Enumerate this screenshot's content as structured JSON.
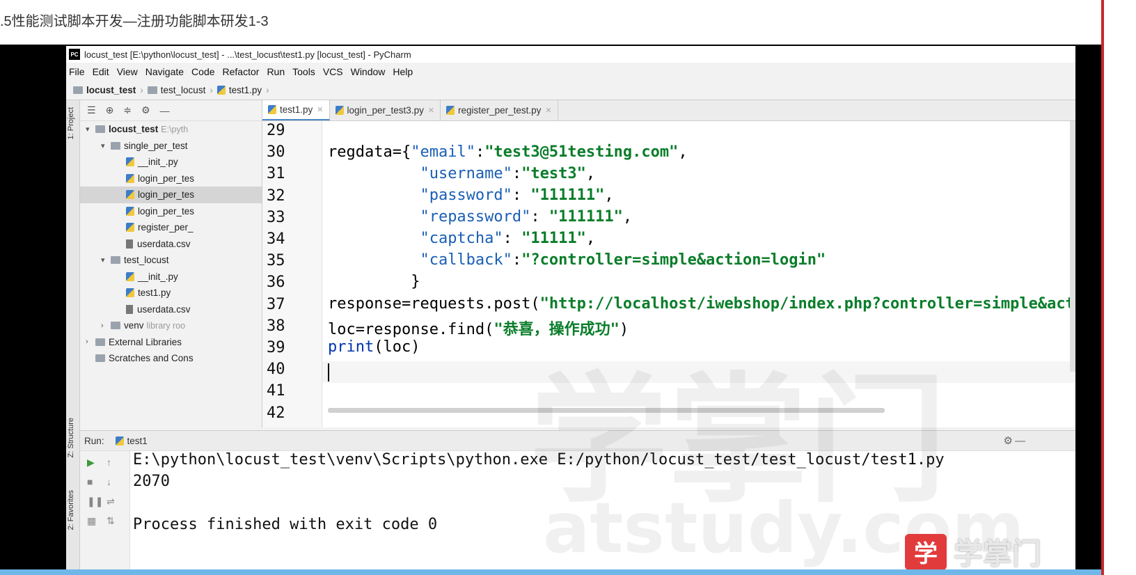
{
  "page_title": ".5性能测试脚本开发—注册功能脚本研发1-3",
  "ide": {
    "window_title": "locust_test [E:\\python\\locust_test] - ...\\test_locust\\test1.py [locust_test] - PyCharm",
    "logo_text": "PC",
    "menu": [
      "File",
      "Edit",
      "View",
      "Navigate",
      "Code",
      "Refactor",
      "Run",
      "Tools",
      "VCS",
      "Window",
      "Help"
    ],
    "breadcrumbs": [
      "locust_test",
      "test_locust",
      "test1.py"
    ],
    "side_labels": {
      "project": "1: Project",
      "structure": "Z: Structure",
      "favorites": "2: Favorites"
    },
    "project_tree": [
      {
        "label": "locust_test",
        "extra": "E:\\pyth",
        "indent": 0,
        "icon": "folder",
        "arrow": "▾",
        "bold": true
      },
      {
        "label": "single_per_test",
        "indent": 1,
        "icon": "folder",
        "arrow": "▾"
      },
      {
        "label": "__init_.py",
        "indent": 2,
        "icon": "py"
      },
      {
        "label": "login_per_tes",
        "indent": 2,
        "icon": "py"
      },
      {
        "label": "login_per_tes",
        "indent": 2,
        "icon": "py",
        "selected": true
      },
      {
        "label": "login_per_tes",
        "indent": 2,
        "icon": "py"
      },
      {
        "label": "register_per_",
        "indent": 2,
        "icon": "py"
      },
      {
        "label": "userdata.csv",
        "indent": 2,
        "icon": "csv"
      },
      {
        "label": "test_locust",
        "indent": 1,
        "icon": "folder",
        "arrow": "▾"
      },
      {
        "label": "__init_.py",
        "indent": 2,
        "icon": "py"
      },
      {
        "label": "test1.py",
        "indent": 2,
        "icon": "py"
      },
      {
        "label": "userdata.csv",
        "indent": 2,
        "icon": "csv"
      },
      {
        "label": "venv",
        "extra": "library roo",
        "indent": 1,
        "icon": "folder",
        "arrow": "›"
      },
      {
        "label": "External Libraries",
        "indent": 0,
        "icon": "lib",
        "arrow": "›"
      },
      {
        "label": "Scratches and Cons",
        "indent": 0,
        "icon": "scratch"
      }
    ],
    "tabs": [
      {
        "label": "test1.py",
        "active": true
      },
      {
        "label": "login_per_test3.py"
      },
      {
        "label": "register_per_test.py"
      }
    ],
    "line_numbers": [
      "29",
      "30",
      "31",
      "32",
      "33",
      "34",
      "35",
      "36",
      "37",
      "38",
      "39",
      "40",
      "41",
      "42"
    ],
    "code": {
      "l30a": "regdata={",
      "l30b": "\"email\"",
      "l30c": ":",
      "l30d": "\"test3@51testing.com\"",
      "l30e": ",",
      "l31a": "\"username\"",
      "l31b": ":",
      "l31c": "\"test3\"",
      "l31d": ",",
      "l32a": "\"password\"",
      "l32b": ": ",
      "l32c": "\"111111\"",
      "l32d": ",",
      "l33a": "\"repassword\"",
      "l33b": ": ",
      "l33c": "\"111111\"",
      "l33d": ",",
      "l34a": "\"captcha\"",
      "l34b": ": ",
      "l34c": "\"11111\"",
      "l34d": ",",
      "l35a": "\"callback\"",
      "l35b": ":",
      "l35c": "\"?controller=simple&action=login\"",
      "l36": "}",
      "l37a": "response=requests.post(",
      "l37b": "\"http://localhost/iwebshop/index.php?controller=simple&action",
      "l38a": "loc=response.find(",
      "l38b": "\"恭喜，操作成功\"",
      "l38c": ")",
      "l39a": "print",
      "l39b": "(loc)"
    },
    "run": {
      "label": "Run:",
      "tab": "test1",
      "console": [
        "E:\\python\\locust_test\\venv\\Scripts\\python.exe E:/python/locust_test/test_locust/test1.py",
        "2070",
        "",
        "Process finished with exit code 0"
      ]
    }
  },
  "watermark": {
    "big": "学掌门",
    "small": "atstudy.com"
  },
  "brand": {
    "box": "学",
    "text": "学掌门"
  },
  "colors": {
    "string": "#0a7d2a",
    "accent_red": "#c62828",
    "brand_red": "#e23b3b"
  }
}
